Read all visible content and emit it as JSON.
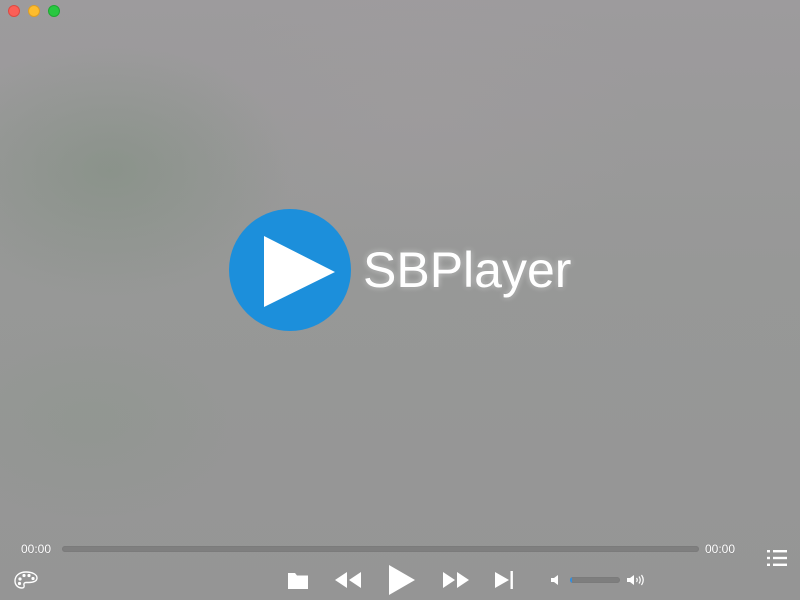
{
  "app": {
    "logo_text": "SBPlayer",
    "brand_color": "#1c8fdb"
  },
  "window": {
    "buttons": [
      {
        "name": "close",
        "color": "#fc5f57"
      },
      {
        "name": "minimize",
        "color": "#fdbc2e"
      },
      {
        "name": "zoom",
        "color": "#28c840"
      }
    ]
  },
  "playback": {
    "current_time": "00:00",
    "duration": "00:00",
    "progress": 0
  },
  "controls": {
    "icons": [
      "skin-palette-icon",
      "open-file-icon",
      "rewind-icon",
      "play-icon",
      "fast-forward-icon",
      "next-track-icon",
      "volume-low-icon",
      "volume-high-icon",
      "playlist-icon"
    ]
  },
  "volume": {
    "level": 0.04,
    "accent": "#2f8ee2"
  }
}
